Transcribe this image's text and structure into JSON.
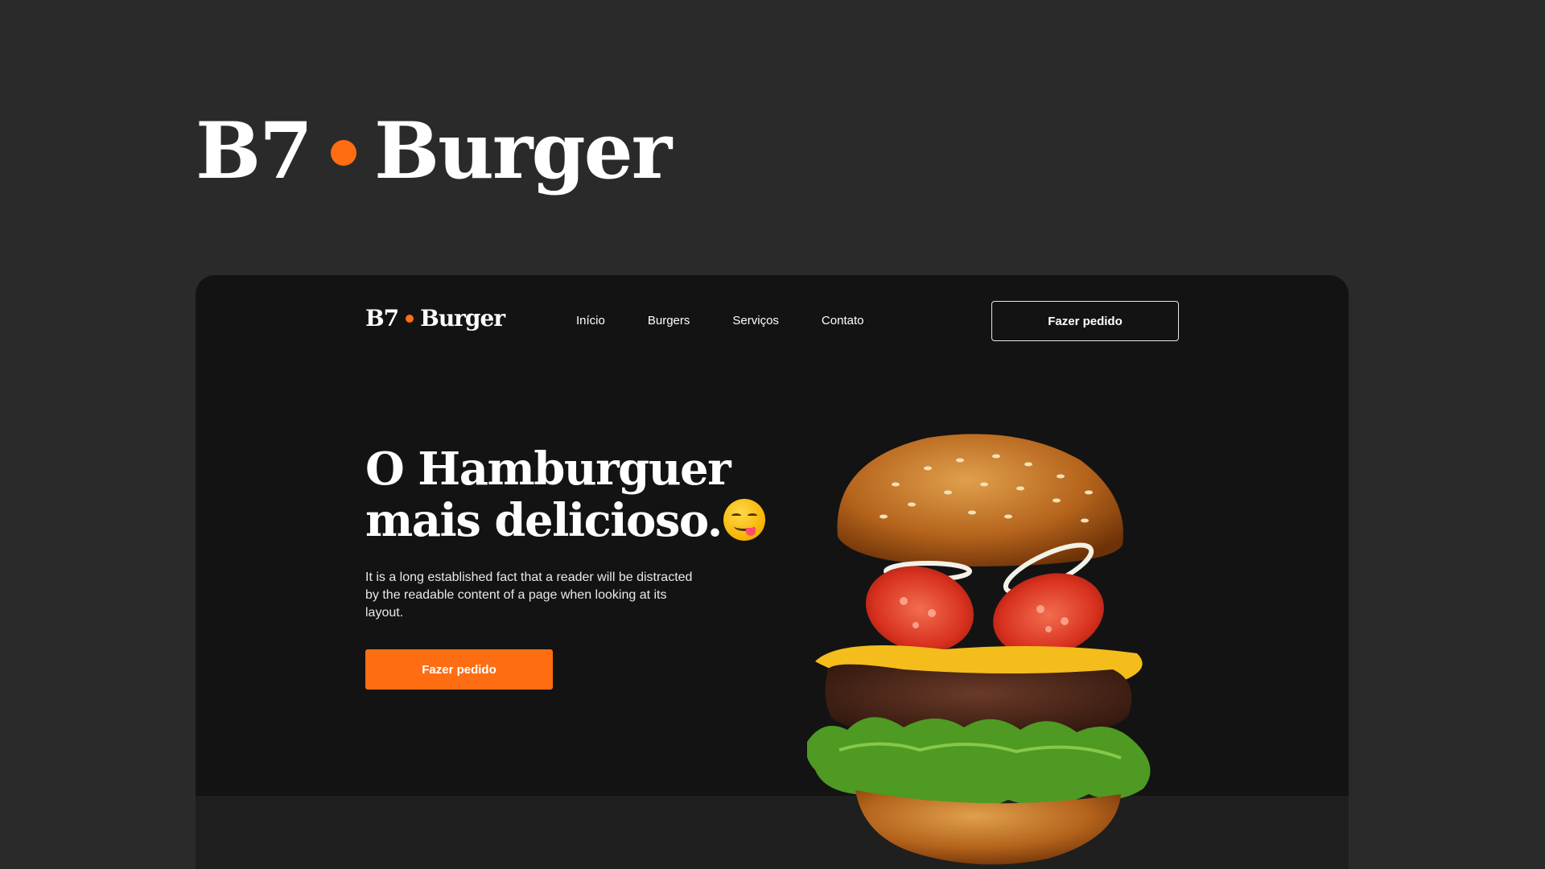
{
  "brand": {
    "name_left": "B7",
    "name_right": "Burger",
    "accent_color": "#ff6d12",
    "background_color": "#2a2a2a"
  },
  "nav": {
    "items": [
      {
        "label": "Início"
      },
      {
        "label": "Burgers"
      },
      {
        "label": "Serviços"
      },
      {
        "label": "Contato"
      }
    ],
    "cta_label": "Fazer pedido"
  },
  "hero": {
    "title_line1": "O Hamburguer",
    "title_line2": "mais delicioso.",
    "emoji": "yum-face-emoji",
    "description": "It is a long established fact that a reader will be distracted by the readable content of a page when looking at its layout.",
    "cta_label": "Fazer pedido",
    "image": "exploded-burger-illustration"
  }
}
